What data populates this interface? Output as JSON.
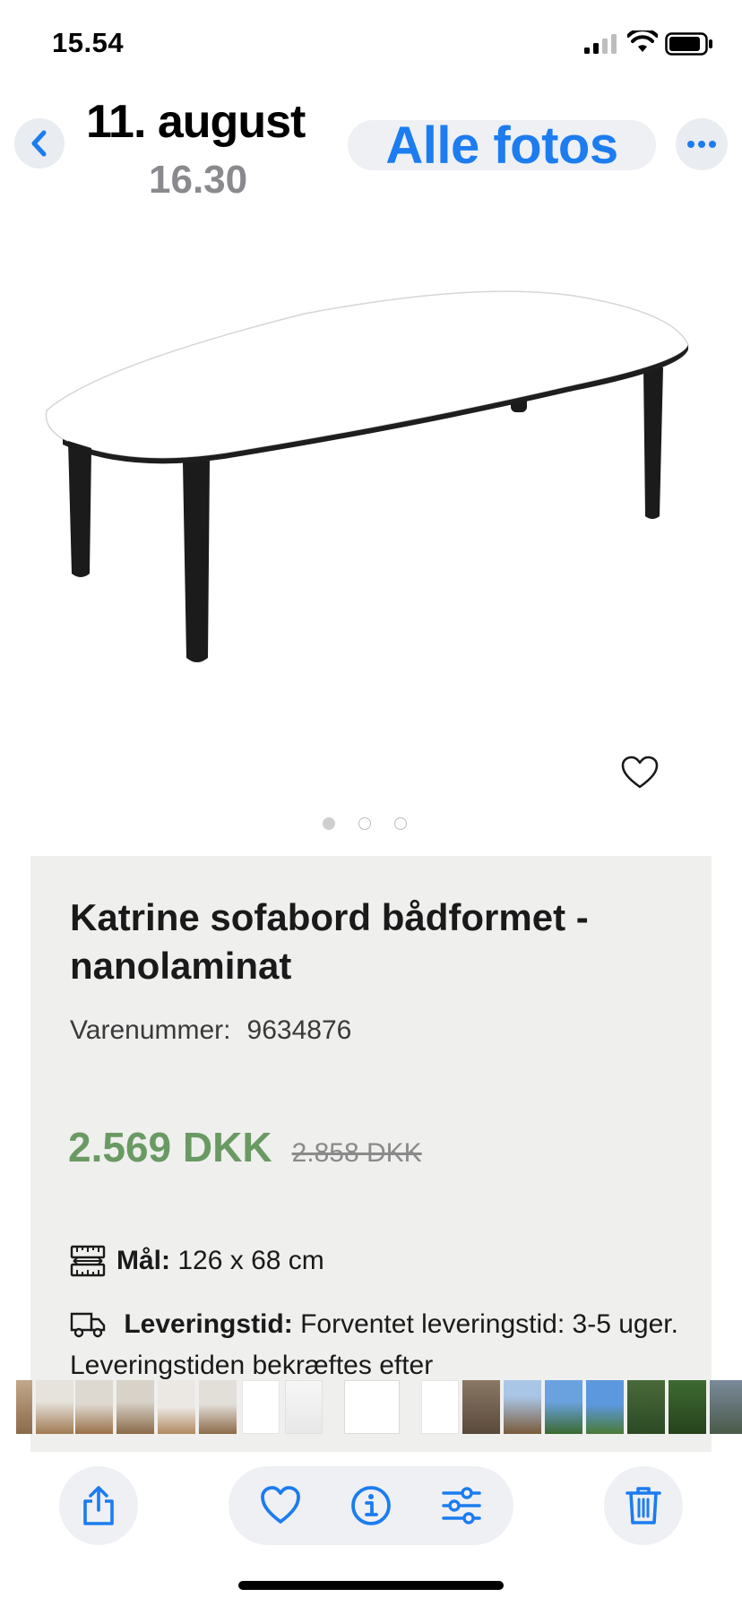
{
  "status_bar": {
    "time": "15.54"
  },
  "header": {
    "date": "11. august",
    "time": "16.30",
    "all_photos_label": "Alle fotos"
  },
  "product": {
    "title": "Katrine sofabord bådformet - nanolaminat",
    "sku_label": "Varenummer:",
    "sku_value": "9634876",
    "price": "2.569 DKK",
    "old_price": "2.858 DKK",
    "dimensions_label": "Mål:",
    "dimensions_value": "126 x 68 cm",
    "delivery_label": "Leveringstid:",
    "delivery_value": "Forventet leveringstid: 3-5 uger. Leveringstiden bekræftes efter"
  },
  "image_pager": {
    "count": 3,
    "active": 1
  },
  "colors": {
    "accent": "#1c7cf0",
    "price_green": "#6a9a63",
    "panel_bg": "#efefee"
  },
  "icons": {
    "back": "chevron-left-icon",
    "more": "ellipsis-icon",
    "favorite": "heart-icon",
    "share": "share-icon",
    "info": "info-icon",
    "adjust": "sliders-icon",
    "delete": "trash-icon"
  }
}
